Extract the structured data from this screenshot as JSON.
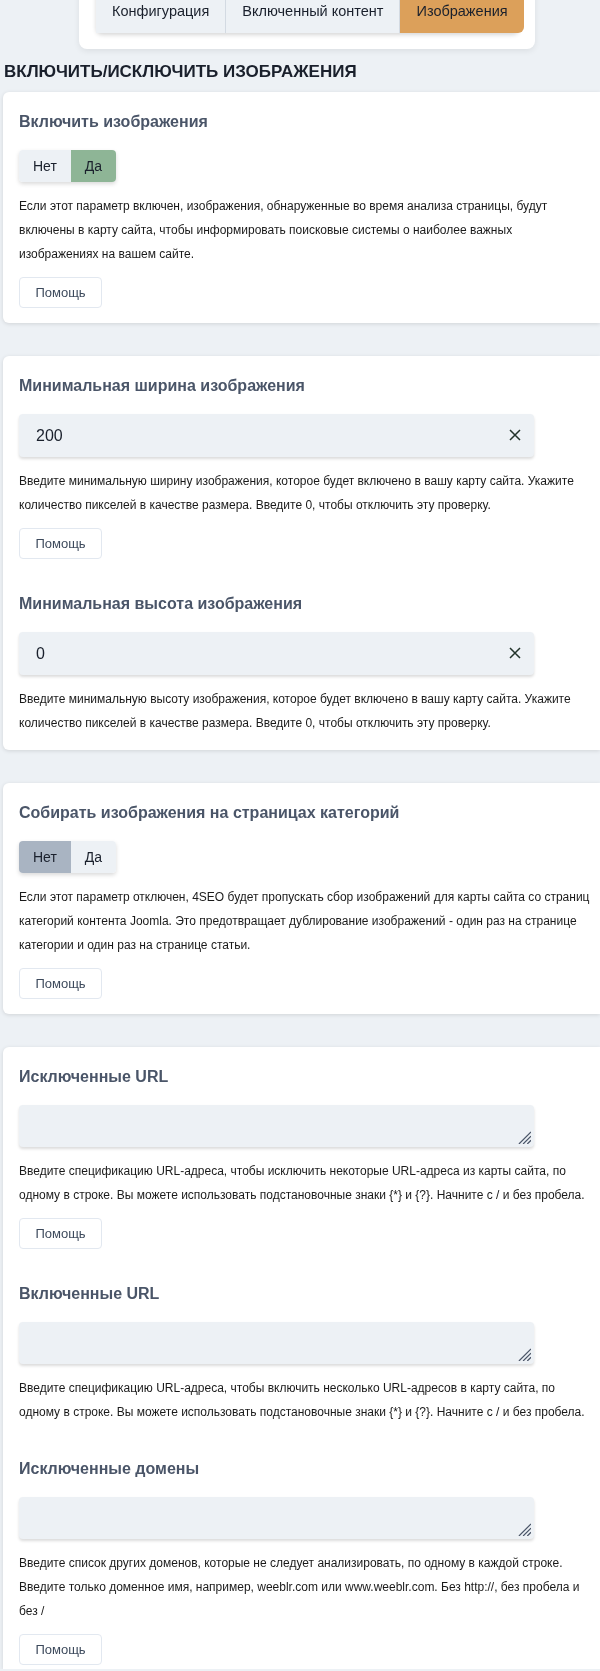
{
  "tabs": [
    {
      "label": "Конфигурация",
      "selected": false
    },
    {
      "label": "Включенный контент",
      "selected": false
    },
    {
      "label": "Изображения",
      "selected": true
    }
  ],
  "section_title": "ВКЛЮЧИТЬ/ИСКЛЮЧИТЬ ИЗОБРАЖЕНИЯ",
  "cards": [
    {
      "fields": [
        {
          "kind": "switch",
          "label": "Включить изображения",
          "options": [
            {
              "label": "Нет",
              "selected": false
            },
            {
              "label": "Да",
              "selected": true
            }
          ],
          "description": "Если этот параметр включен, изображения, обнаруженные во время анализа страницы, будут включены в карту сайта, чтобы информировать поисковые системы о наиболее важных изображениях на вашем сайте.",
          "help_button": "Помощь"
        }
      ]
    },
    {
      "fields": [
        {
          "kind": "number",
          "label": "Минимальная ширина изображения",
          "value": "200",
          "description": "Введите минимальную ширину изображения, которое будет включено в вашу карту сайта. Укажите количество пикселей в качестве размера. Введите 0, чтобы отключить эту проверку.",
          "help_button": "Помощь"
        },
        {
          "kind": "number",
          "label": "Минимальная высота изображения",
          "value": "0",
          "description": "Введите минимальную высоту изображения, которое будет включено в вашу карту сайта. Укажите количество пикселей в качестве размера. Введите 0, чтобы отключить эту проверку."
        }
      ]
    },
    {
      "fields": [
        {
          "kind": "switch",
          "label": "Собирать изображения на страницах категорий",
          "options": [
            {
              "label": "Нет",
              "selected": true
            },
            {
              "label": "Да",
              "selected": false
            }
          ],
          "description": "Если этот параметр отключен, 4SEO будет пропускать сбор изображений для карты сайта со страниц категорий контента Joomla. Это предотвращает дублирование изображений - один раз на странице категории и один раз на странице статьи.",
          "help_button": "Помощь"
        }
      ]
    },
    {
      "fields": [
        {
          "kind": "textarea",
          "label": "Исключенные URL",
          "description": "Введите спецификацию URL-адреса, чтобы исключить некоторые URL-адреса из карты сайта, по одному в строке. Вы можете использовать подстановочные знаки {*} и {?}. Начните с / и без пробела.",
          "help_button": "Помощь"
        },
        {
          "kind": "textarea",
          "label": "Включенные URL",
          "description": "Введите спецификацию URL-адреса, чтобы включить несколько URL-адресов в карту сайта, по одному в строке. Вы можете использовать подстановочные знаки {*} и {?}. Начните с / и без пробела."
        },
        {
          "kind": "textarea",
          "label": "Исключенные домены",
          "description": "Введите список других доменов, которые не следует анализировать, по одному в каждой строке. Введите только доменное имя, например, weeblr.com или www.weeblr.com. Без http://, без пробела и без /",
          "help_button": "Помощь"
        }
      ]
    }
  ]
}
